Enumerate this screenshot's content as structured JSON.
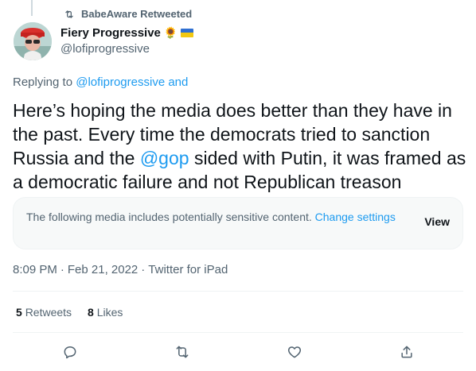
{
  "retweet": {
    "label": "BabeAware Retweeted",
    "icon": "retweet-icon"
  },
  "author": {
    "display_name": "Fiery Progressive",
    "emoji": "🌻",
    "handle": "@lofiprogressive",
    "avatar_icon": "avatar"
  },
  "replying": {
    "prefix": "Replying to",
    "link": "@lofiprogressive and"
  },
  "tweet": {
    "text_1": "Here’s hoping the media does better than they have in the past. Every time the democrats tried to sanction Russia and the ",
    "mention": "@gop",
    "text_2": " sided with Putin, it was framed as a democratic failure and not Republican treason"
  },
  "sensitive": {
    "text": "The following media includes potentially sensitive content.",
    "link": "Change settings",
    "view_label": "View"
  },
  "meta": {
    "time": "8:09 PM",
    "sep": "·",
    "date": "Feb 21, 2022",
    "source": "Twitter for iPad"
  },
  "stats": {
    "retweets_count": "5",
    "retweets_label": "Retweets",
    "likes_count": "8",
    "likes_label": "Likes"
  },
  "colors": {
    "accent": "#1d9bf0",
    "muted": "#536471",
    "text": "#0f1419"
  }
}
